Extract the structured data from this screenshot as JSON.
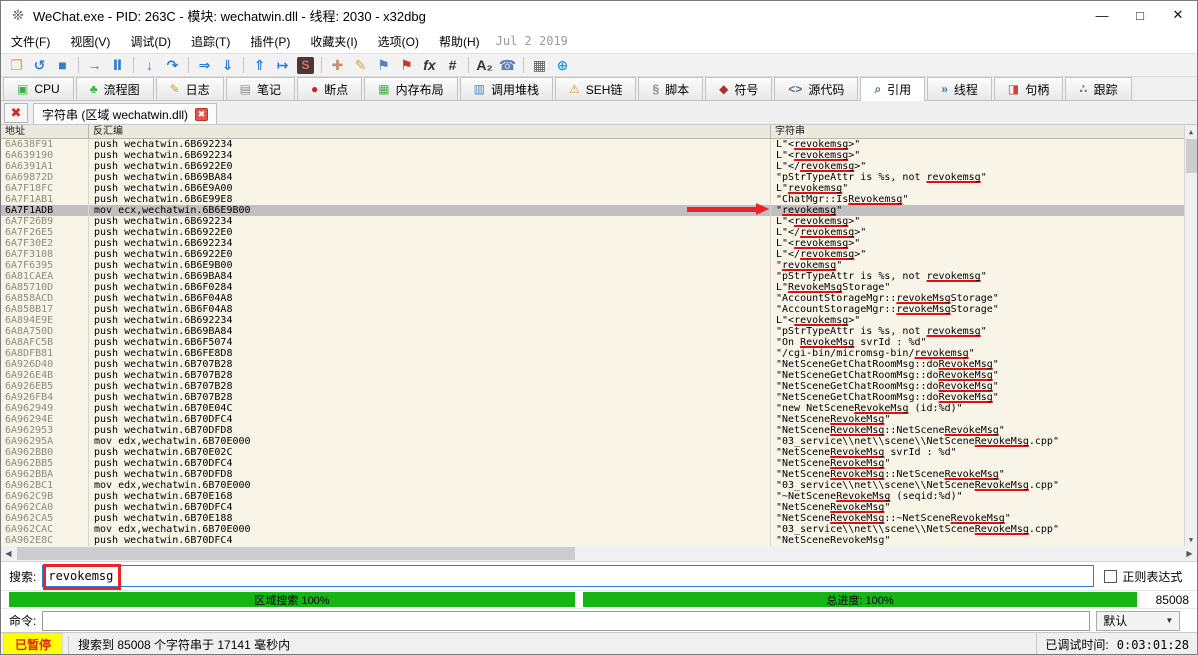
{
  "window": {
    "title": "WeChat.exe - PID: 263C - 模块: wechatwin.dll - 线程: 2030 - x32dbg",
    "controls": {
      "minimize": "—",
      "maximize": "□",
      "close": "✕"
    }
  },
  "menu_bar": {
    "items": [
      "文件(F)",
      "视图(V)",
      "调试(D)",
      "追踪(T)",
      "插件(P)",
      "收藏夹(I)",
      "选项(O)",
      "帮助(H)"
    ],
    "build_date": "Jul 2 2019"
  },
  "toolbar": {
    "icons": [
      {
        "name": "open-file-icon",
        "glyph": "❐",
        "color": "#dfa23c"
      },
      {
        "name": "restart-icon",
        "glyph": "↺",
        "color": "#2b7cd3"
      },
      {
        "name": "stop-icon",
        "glyph": "■",
        "color": "#2f7fd6"
      },
      {
        "sep": true
      },
      {
        "name": "run-icon",
        "glyph": "→",
        "color": "#2b7cd3"
      },
      {
        "name": "pause-icon",
        "glyph": "Ⅱ",
        "color": "#2b7cd3"
      },
      {
        "sep": true
      },
      {
        "name": "step-into-icon",
        "glyph": "↓",
        "color": "#2b7cd3"
      },
      {
        "name": "step-over-icon",
        "glyph": "↷",
        "color": "#2b7cd3"
      },
      {
        "sep": true
      },
      {
        "name": "execute-till-return-icon",
        "glyph": "⇒",
        "color": "#2b7cd3"
      },
      {
        "name": "skip-icon",
        "glyph": "⇓",
        "color": "#2b7cd3"
      },
      {
        "sep": true
      },
      {
        "name": "step-out-icon",
        "glyph": "⇑",
        "color": "#2b7cd3"
      },
      {
        "name": "run-to-user-code-icon",
        "glyph": "↦",
        "color": "#2b7cd3"
      },
      {
        "name": "scylla-icon",
        "glyph": "S",
        "color": "#e06a6a",
        "bg": "#4a3636"
      },
      {
        "sep": true
      },
      {
        "name": "patch-icon",
        "glyph": "✚",
        "color": "#c98f6e"
      },
      {
        "name": "comment-icon",
        "glyph": "✎",
        "color": "#d6a441"
      },
      {
        "name": "label-icon",
        "glyph": "⚑",
        "color": "#4f81bd"
      },
      {
        "name": "bookmark-icon",
        "glyph": "⚑",
        "color": "#c0392b"
      },
      {
        "name": "function-icon",
        "glyph": "fx",
        "color": "#333333"
      },
      {
        "name": "hash-icon",
        "glyph": "#",
        "color": "#333333"
      },
      {
        "sep": true
      },
      {
        "name": "char-table-icon",
        "glyph": "A₂",
        "color": "#333333"
      },
      {
        "name": "report-device-icon",
        "glyph": "☎",
        "color": "#5a7fb0"
      },
      {
        "sep": true
      },
      {
        "name": "calculator-icon",
        "glyph": "▦",
        "color": "#5a5a5a"
      },
      {
        "name": "globe-icon",
        "glyph": "⊕",
        "color": "#2b9cd3"
      }
    ]
  },
  "tabs": [
    {
      "id": "cpu",
      "label": "CPU",
      "icon": "cpu-icon",
      "glyph": "▣",
      "color": "#3fae49",
      "active": false
    },
    {
      "id": "graph",
      "label": "流程图",
      "icon": "graph-icon",
      "glyph": "♣",
      "color": "#3fae49",
      "active": false
    },
    {
      "id": "log",
      "label": "日志",
      "icon": "log-icon",
      "glyph": "✎",
      "color": "#c9a227",
      "active": false
    },
    {
      "id": "notes",
      "label": "笔记",
      "icon": "notes-icon",
      "glyph": "▤",
      "color": "#8a8a8a",
      "active": false
    },
    {
      "id": "breakpoints",
      "label": "断点",
      "icon": "breakpoint-icon",
      "glyph": "●",
      "color": "#cc2222",
      "active": false
    },
    {
      "id": "memory-map",
      "label": "内存布局",
      "icon": "memory-map-icon",
      "glyph": "▦",
      "color": "#3fae49",
      "active": false
    },
    {
      "id": "call-stack",
      "label": "调用堆栈",
      "icon": "call-stack-icon",
      "glyph": "▥",
      "color": "#4f81bd",
      "active": false
    },
    {
      "id": "seh-chain",
      "label": "SEH链",
      "icon": "seh-chain-icon",
      "glyph": "⚠",
      "color": "#c9a227",
      "active": false
    },
    {
      "id": "script",
      "label": "脚本",
      "icon": "script-icon",
      "glyph": "§",
      "color": "#8a8a8a",
      "active": false
    },
    {
      "id": "symbols",
      "label": "符号",
      "icon": "symbols-icon",
      "glyph": "◆",
      "color": "#b03030",
      "active": false
    },
    {
      "id": "source",
      "label": "源代码",
      "icon": "source-code-icon",
      "glyph": "<>",
      "color": "#607080",
      "active": false
    },
    {
      "id": "references",
      "label": "引用",
      "icon": "references-search-icon",
      "glyph": "⌕",
      "color": "#607080",
      "active": true
    },
    {
      "id": "threads",
      "label": "线程",
      "icon": "threads-icon",
      "glyph": "»",
      "color": "#2b7cd3",
      "active": false
    },
    {
      "id": "handles",
      "label": "句柄",
      "icon": "handles-icon",
      "glyph": "◨",
      "color": "#cc4433",
      "active": false
    },
    {
      "id": "trace",
      "label": "跟踪",
      "icon": "trace-icon",
      "glyph": "∴",
      "color": "#777777",
      "active": false
    }
  ],
  "doc_tab_bar": {
    "close_all_glyph": "✖",
    "tab": {
      "label": "字符串 (区域 wechatwin.dll)",
      "close_glyph": "✖"
    }
  },
  "strings_table": {
    "columns": [
      "地址",
      "反汇编",
      "字符串"
    ],
    "selected_address": "6A7F1ADB",
    "rows": [
      {
        "a": "6A638F91",
        "d": "push wechatwin.6B692234",
        "s": [
          [
            "L\"<",
            0
          ],
          [
            "revokemsg",
            1
          ],
          [
            ">\"",
            0
          ]
        ]
      },
      {
        "a": "6A639190",
        "d": "push wechatwin.6B692234",
        "s": [
          [
            "L\"<",
            0
          ],
          [
            "revokemsg",
            1
          ],
          [
            ">\"",
            0
          ]
        ]
      },
      {
        "a": "6A6391A1",
        "d": "push wechatwin.6B6922E0",
        "s": [
          [
            "L\"</",
            0
          ],
          [
            "revokemsg",
            1
          ],
          [
            ">\"",
            0
          ]
        ]
      },
      {
        "a": "6A69872D",
        "d": "push wechatwin.6B69BA84",
        "s": [
          [
            "\"pStrTypeAttr is %s, not ",
            0
          ],
          [
            "revokemsg",
            1
          ],
          [
            "\"",
            0
          ]
        ]
      },
      {
        "a": "6A7F18FC",
        "d": "push wechatwin.6B6E9A00",
        "s": [
          [
            "L\"",
            0
          ],
          [
            "revokemsg",
            1
          ],
          [
            "\"",
            0
          ]
        ]
      },
      {
        "a": "6A7F1AB1",
        "d": "push wechatwin.6B6E99E8",
        "s": [
          [
            "\"ChatMgr::Is",
            0
          ],
          [
            "Revokemsg",
            1
          ],
          [
            "\"",
            0
          ]
        ]
      },
      {
        "a": "6A7F1ADB",
        "d": "mov ecx,wechatwin.6B6E9B00",
        "s": [
          [
            "\"",
            0
          ],
          [
            "revokemsg",
            1
          ],
          [
            "\"",
            0
          ]
        ]
      },
      {
        "a": "6A7F26B9",
        "d": "push wechatwin.6B692234",
        "s": [
          [
            "L\"<",
            0
          ],
          [
            "revokemsg",
            1
          ],
          [
            ">\"",
            0
          ]
        ]
      },
      {
        "a": "6A7F26E5",
        "d": "push wechatwin.6B6922E0",
        "s": [
          [
            "L\"</",
            0
          ],
          [
            "revokemsg",
            1
          ],
          [
            ">\"",
            0
          ]
        ]
      },
      {
        "a": "6A7F30E2",
        "d": "push wechatwin.6B692234",
        "s": [
          [
            "L\"<",
            0
          ],
          [
            "revokemsg",
            1
          ],
          [
            ">\"",
            0
          ]
        ]
      },
      {
        "a": "6A7F3108",
        "d": "push wechatwin.6B6922E0",
        "s": [
          [
            "L\"</",
            0
          ],
          [
            "revokemsg",
            1
          ],
          [
            ">\"",
            0
          ]
        ]
      },
      {
        "a": "6A7F6395",
        "d": "push wechatwin.6B6E9B00",
        "s": [
          [
            "\"",
            0
          ],
          [
            "revokemsg",
            1
          ],
          [
            "\"",
            0
          ]
        ]
      },
      {
        "a": "6A81CAEA",
        "d": "push wechatwin.6B69BA84",
        "s": [
          [
            "\"pStrTypeAttr is %s, not ",
            0
          ],
          [
            "revokemsg",
            1
          ],
          [
            "\"",
            0
          ]
        ]
      },
      {
        "a": "6A85710D",
        "d": "push wechatwin.6B6F0284",
        "s": [
          [
            "L\"",
            0
          ],
          [
            "RevokeMsg",
            1
          ],
          [
            "Storage\"",
            0
          ]
        ]
      },
      {
        "a": "6A858ACD",
        "d": "push wechatwin.6B6F04A8",
        "s": [
          [
            "\"AccountStorageMgr::",
            0
          ],
          [
            "revokeMsg",
            1
          ],
          [
            "Storage\"",
            0
          ]
        ]
      },
      {
        "a": "6A858B17",
        "d": "push wechatwin.6B6F04A8",
        "s": [
          [
            "\"AccountStorageMgr::",
            0
          ],
          [
            "revokeMsg",
            1
          ],
          [
            "Storage\"",
            0
          ]
        ]
      },
      {
        "a": "6A894E9E",
        "d": "push wechatwin.6B692234",
        "s": [
          [
            "L\"<",
            0
          ],
          [
            "revokemsg",
            1
          ],
          [
            ">\"",
            0
          ]
        ]
      },
      {
        "a": "6A8A750D",
        "d": "push wechatwin.6B69BA84",
        "s": [
          [
            "\"pStrTypeAttr is %s, not ",
            0
          ],
          [
            "revokemsg",
            1
          ],
          [
            "\"",
            0
          ]
        ]
      },
      {
        "a": "6A8AFC5B",
        "d": "push wechatwin.6B6F5074",
        "s": [
          [
            "\"On ",
            0
          ],
          [
            "RevokeMsg",
            1
          ],
          [
            " svrId : %d\"",
            0
          ]
        ]
      },
      {
        "a": "6A8DFB81",
        "d": "push wechatwin.6B6FE8D8",
        "s": [
          [
            "\"/cgi-bin/micromsg-bin/",
            0
          ],
          [
            "revokemsg",
            1
          ],
          [
            "\"",
            0
          ]
        ]
      },
      {
        "a": "6A926D40",
        "d": "push wechatwin.6B707B28",
        "s": [
          [
            "\"NetSceneGetChatRoomMsg::do",
            0
          ],
          [
            "RevokeMsg",
            1
          ],
          [
            "\"",
            0
          ]
        ]
      },
      {
        "a": "6A926E4B",
        "d": "push wechatwin.6B707B28",
        "s": [
          [
            "\"NetSceneGetChatRoomMsg::do",
            0
          ],
          [
            "RevokeMsg",
            1
          ],
          [
            "\"",
            0
          ]
        ]
      },
      {
        "a": "6A926EB5",
        "d": "push wechatwin.6B707B28",
        "s": [
          [
            "\"NetSceneGetChatRoomMsg::do",
            0
          ],
          [
            "RevokeMsg",
            1
          ],
          [
            "\"",
            0
          ]
        ]
      },
      {
        "a": "6A926FB4",
        "d": "push wechatwin.6B707B28",
        "s": [
          [
            "\"NetSceneGetChatRoomMsg::do",
            0
          ],
          [
            "RevokeMsg",
            1
          ],
          [
            "\"",
            0
          ]
        ]
      },
      {
        "a": "6A962949",
        "d": "push wechatwin.6B70E04C",
        "s": [
          [
            "\"new NetScene",
            0
          ],
          [
            "RevokeMsg",
            1
          ],
          [
            " (id:%d)\"",
            0
          ]
        ]
      },
      {
        "a": "6A96294E",
        "d": "push wechatwin.6B70DFC4",
        "s": [
          [
            "\"NetScene",
            0
          ],
          [
            "RevokeMsg",
            1
          ],
          [
            "\"",
            0
          ]
        ]
      },
      {
        "a": "6A962953",
        "d": "push wechatwin.6B70DFD8",
        "s": [
          [
            "\"NetScene",
            0
          ],
          [
            "RevokeMsg",
            1
          ],
          [
            "::NetScene",
            0
          ],
          [
            "RevokeMsg",
            1
          ],
          [
            "\"",
            0
          ]
        ]
      },
      {
        "a": "6A96295A",
        "d": "mov edx,wechatwin.6B70E000",
        "s": [
          [
            "\"03_service\\\\net\\\\scene\\\\NetScene",
            0
          ],
          [
            "RevokeMsg",
            1
          ],
          [
            ".cpp\"",
            0
          ]
        ]
      },
      {
        "a": "6A962BB0",
        "d": "push wechatwin.6B70E02C",
        "s": [
          [
            "\"NetScene",
            0
          ],
          [
            "RevokeMsg",
            1
          ],
          [
            " svrId : %d\"",
            0
          ]
        ]
      },
      {
        "a": "6A962BB5",
        "d": "push wechatwin.6B70DFC4",
        "s": [
          [
            "\"NetScene",
            0
          ],
          [
            "RevokeMsg",
            1
          ],
          [
            "\"",
            0
          ]
        ]
      },
      {
        "a": "6A962BBA",
        "d": "push wechatwin.6B70DFD8",
        "s": [
          [
            "\"NetScene",
            0
          ],
          [
            "RevokeMsg",
            1
          ],
          [
            "::NetScene",
            0
          ],
          [
            "RevokeMsg",
            1
          ],
          [
            "\"",
            0
          ]
        ]
      },
      {
        "a": "6A962BC1",
        "d": "mov edx,wechatwin.6B70E000",
        "s": [
          [
            "\"03_service\\\\net\\\\scene\\\\NetScene",
            0
          ],
          [
            "RevokeMsg",
            1
          ],
          [
            ".cpp\"",
            0
          ]
        ]
      },
      {
        "a": "6A962C9B",
        "d": "push wechatwin.6B70E168",
        "s": [
          [
            "\"~NetScene",
            0
          ],
          [
            "RevokeMsg",
            1
          ],
          [
            " (seqid:%d)\"",
            0
          ]
        ]
      },
      {
        "a": "6A962CA0",
        "d": "push wechatwin.6B70DFC4",
        "s": [
          [
            "\"NetScene",
            0
          ],
          [
            "RevokeMsg",
            1
          ],
          [
            "\"",
            0
          ]
        ]
      },
      {
        "a": "6A962CA5",
        "d": "push wechatwin.6B70E188",
        "s": [
          [
            "\"NetScene",
            0
          ],
          [
            "RevokeMsg",
            1
          ],
          [
            "::~NetScene",
            0
          ],
          [
            "RevokeMsg",
            1
          ],
          [
            "\"",
            0
          ]
        ]
      },
      {
        "a": "6A962CAC",
        "d": "mov edx,wechatwin.6B70E000",
        "s": [
          [
            "\"03_service\\\\net\\\\scene\\\\NetScene",
            0
          ],
          [
            "RevokeMsg",
            1
          ],
          [
            ".cpp\"",
            0
          ]
        ]
      },
      {
        "a": "6A962E8C",
        "d": "push wechatwin.6B70DFC4",
        "s": [
          [
            "\"NetSceneRevokeMsg\"",
            0
          ]
        ]
      }
    ]
  },
  "search_bar": {
    "label": "搜索:",
    "value": "revokemsg",
    "regex_label": "正则表达式",
    "regex_checked": false
  },
  "progress": {
    "range_label": "区域搜索 100%",
    "total_label": "总进度: 100%",
    "count": "85008"
  },
  "command_bar": {
    "label": "命令:",
    "value": "",
    "profile_label": "默认"
  },
  "status_bar": {
    "state": "已暂停",
    "message": "搜索到 85008 个字符串于 17141 毫秒内",
    "debug_time_label": "已调试时间:",
    "debug_time": "0:03:01:28"
  },
  "colors": {
    "highlight_underline": "#dd1111",
    "selected_row": "#c0c0c0",
    "progress_green": "#16b516",
    "status_state_bg": "#ffff00",
    "status_state_text": "#e0261c",
    "annotation_red": "#e8232a",
    "table_bg": "#f8f4e8"
  }
}
